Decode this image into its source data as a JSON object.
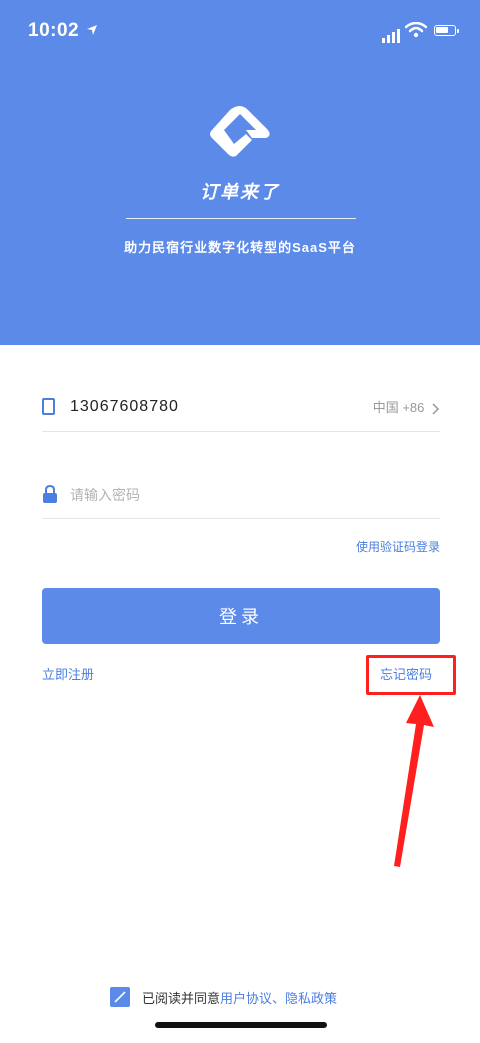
{
  "status_bar": {
    "time": "10:02"
  },
  "hero": {
    "app_name": "订单来了",
    "tagline": "助力民宿行业数字化转型的SaaS平台"
  },
  "login_form": {
    "phone_value": "13067608780",
    "country_code": "中国 +86",
    "password_placeholder": "请输入密码",
    "code_login_label": "使用验证码登录",
    "login_button_label": "登录",
    "register_label": "立即注册",
    "forgot_label": "忘记密码"
  },
  "agreement": {
    "prefix": "已阅读并同意",
    "user_agreement": "用户协议",
    "separator": "、",
    "privacy_policy": "隐私政策"
  },
  "colors": {
    "brand_blue": "#5b8ae8",
    "link_blue": "#4a7ee0",
    "annotation_red": "#ff1f1f"
  }
}
